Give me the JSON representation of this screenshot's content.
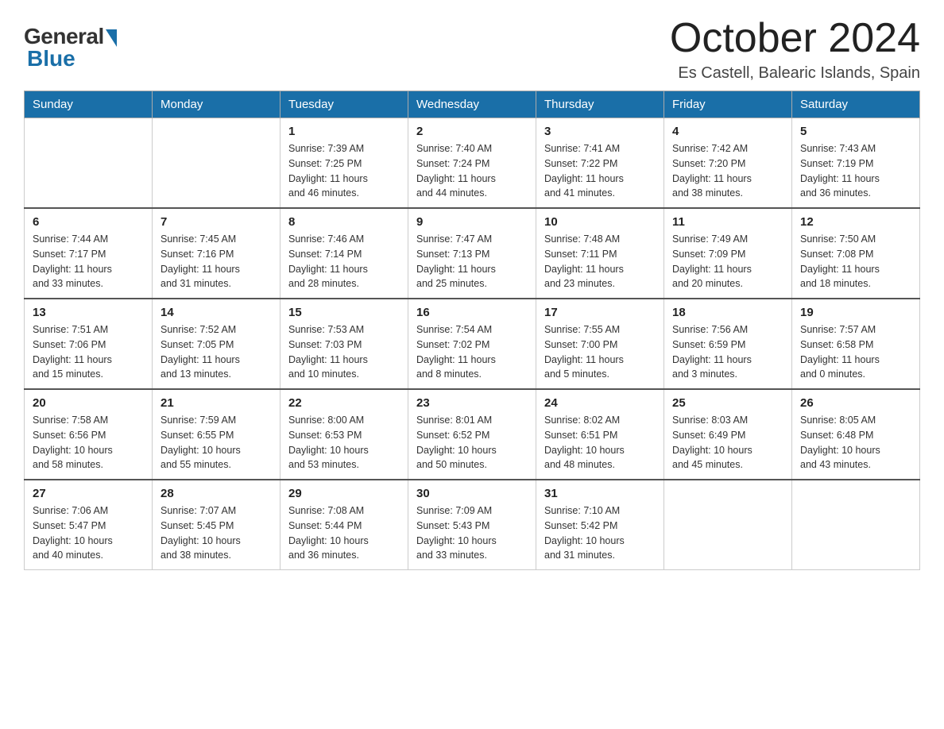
{
  "header": {
    "logo_general": "General",
    "logo_blue": "Blue",
    "month_title": "October 2024",
    "location": "Es Castell, Balearic Islands, Spain"
  },
  "weekdays": [
    "Sunday",
    "Monday",
    "Tuesday",
    "Wednesday",
    "Thursday",
    "Friday",
    "Saturday"
  ],
  "weeks": [
    [
      {
        "day": "",
        "info": ""
      },
      {
        "day": "",
        "info": ""
      },
      {
        "day": "1",
        "info": "Sunrise: 7:39 AM\nSunset: 7:25 PM\nDaylight: 11 hours\nand 46 minutes."
      },
      {
        "day": "2",
        "info": "Sunrise: 7:40 AM\nSunset: 7:24 PM\nDaylight: 11 hours\nand 44 minutes."
      },
      {
        "day": "3",
        "info": "Sunrise: 7:41 AM\nSunset: 7:22 PM\nDaylight: 11 hours\nand 41 minutes."
      },
      {
        "day": "4",
        "info": "Sunrise: 7:42 AM\nSunset: 7:20 PM\nDaylight: 11 hours\nand 38 minutes."
      },
      {
        "day": "5",
        "info": "Sunrise: 7:43 AM\nSunset: 7:19 PM\nDaylight: 11 hours\nand 36 minutes."
      }
    ],
    [
      {
        "day": "6",
        "info": "Sunrise: 7:44 AM\nSunset: 7:17 PM\nDaylight: 11 hours\nand 33 minutes."
      },
      {
        "day": "7",
        "info": "Sunrise: 7:45 AM\nSunset: 7:16 PM\nDaylight: 11 hours\nand 31 minutes."
      },
      {
        "day": "8",
        "info": "Sunrise: 7:46 AM\nSunset: 7:14 PM\nDaylight: 11 hours\nand 28 minutes."
      },
      {
        "day": "9",
        "info": "Sunrise: 7:47 AM\nSunset: 7:13 PM\nDaylight: 11 hours\nand 25 minutes."
      },
      {
        "day": "10",
        "info": "Sunrise: 7:48 AM\nSunset: 7:11 PM\nDaylight: 11 hours\nand 23 minutes."
      },
      {
        "day": "11",
        "info": "Sunrise: 7:49 AM\nSunset: 7:09 PM\nDaylight: 11 hours\nand 20 minutes."
      },
      {
        "day": "12",
        "info": "Sunrise: 7:50 AM\nSunset: 7:08 PM\nDaylight: 11 hours\nand 18 minutes."
      }
    ],
    [
      {
        "day": "13",
        "info": "Sunrise: 7:51 AM\nSunset: 7:06 PM\nDaylight: 11 hours\nand 15 minutes."
      },
      {
        "day": "14",
        "info": "Sunrise: 7:52 AM\nSunset: 7:05 PM\nDaylight: 11 hours\nand 13 minutes."
      },
      {
        "day": "15",
        "info": "Sunrise: 7:53 AM\nSunset: 7:03 PM\nDaylight: 11 hours\nand 10 minutes."
      },
      {
        "day": "16",
        "info": "Sunrise: 7:54 AM\nSunset: 7:02 PM\nDaylight: 11 hours\nand 8 minutes."
      },
      {
        "day": "17",
        "info": "Sunrise: 7:55 AM\nSunset: 7:00 PM\nDaylight: 11 hours\nand 5 minutes."
      },
      {
        "day": "18",
        "info": "Sunrise: 7:56 AM\nSunset: 6:59 PM\nDaylight: 11 hours\nand 3 minutes."
      },
      {
        "day": "19",
        "info": "Sunrise: 7:57 AM\nSunset: 6:58 PM\nDaylight: 11 hours\nand 0 minutes."
      }
    ],
    [
      {
        "day": "20",
        "info": "Sunrise: 7:58 AM\nSunset: 6:56 PM\nDaylight: 10 hours\nand 58 minutes."
      },
      {
        "day": "21",
        "info": "Sunrise: 7:59 AM\nSunset: 6:55 PM\nDaylight: 10 hours\nand 55 minutes."
      },
      {
        "day": "22",
        "info": "Sunrise: 8:00 AM\nSunset: 6:53 PM\nDaylight: 10 hours\nand 53 minutes."
      },
      {
        "day": "23",
        "info": "Sunrise: 8:01 AM\nSunset: 6:52 PM\nDaylight: 10 hours\nand 50 minutes."
      },
      {
        "day": "24",
        "info": "Sunrise: 8:02 AM\nSunset: 6:51 PM\nDaylight: 10 hours\nand 48 minutes."
      },
      {
        "day": "25",
        "info": "Sunrise: 8:03 AM\nSunset: 6:49 PM\nDaylight: 10 hours\nand 45 minutes."
      },
      {
        "day": "26",
        "info": "Sunrise: 8:05 AM\nSunset: 6:48 PM\nDaylight: 10 hours\nand 43 minutes."
      }
    ],
    [
      {
        "day": "27",
        "info": "Sunrise: 7:06 AM\nSunset: 5:47 PM\nDaylight: 10 hours\nand 40 minutes."
      },
      {
        "day": "28",
        "info": "Sunrise: 7:07 AM\nSunset: 5:45 PM\nDaylight: 10 hours\nand 38 minutes."
      },
      {
        "day": "29",
        "info": "Sunrise: 7:08 AM\nSunset: 5:44 PM\nDaylight: 10 hours\nand 36 minutes."
      },
      {
        "day": "30",
        "info": "Sunrise: 7:09 AM\nSunset: 5:43 PM\nDaylight: 10 hours\nand 33 minutes."
      },
      {
        "day": "31",
        "info": "Sunrise: 7:10 AM\nSunset: 5:42 PM\nDaylight: 10 hours\nand 31 minutes."
      },
      {
        "day": "",
        "info": ""
      },
      {
        "day": "",
        "info": ""
      }
    ]
  ]
}
